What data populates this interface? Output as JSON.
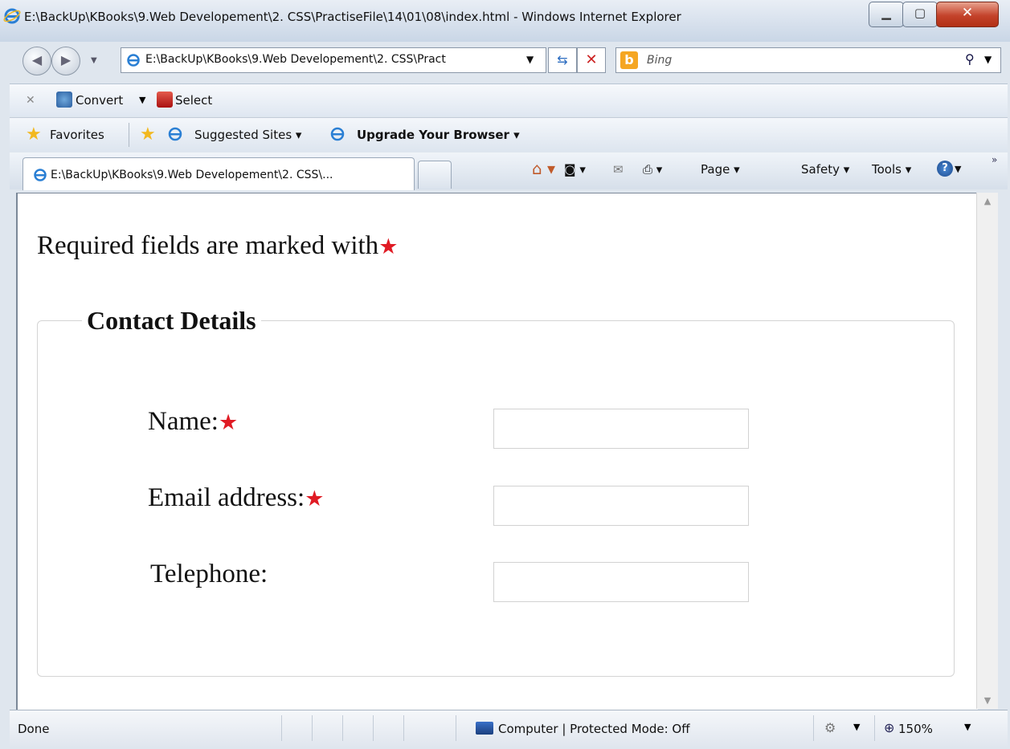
{
  "window": {
    "title": "E:\\BackUp\\KBooks\\9.Web Developement\\2. CSS\\PractiseFile\\14\\01\\08\\index.html - Windows Internet Explorer"
  },
  "address": {
    "url": "E:\\BackUp\\KBooks\\9.Web Developement\\2. CSS\\Pract",
    "search_placeholder": "Bing"
  },
  "command_bar": {
    "convert_label": "Convert",
    "select_label": "Select"
  },
  "favorites_bar": {
    "favorites_label": "Favorites",
    "suggested_sites_label": "Suggested Sites ▾",
    "upgrade_label": "Upgrade Your Browser ▾"
  },
  "tab": {
    "title": "E:\\BackUp\\KBooks\\9.Web Developement\\2. CSS\\..."
  },
  "toolbar": {
    "page_label": "Page ▾",
    "safety_label": "Safety ▾",
    "tools_label": "Tools ▾"
  },
  "page": {
    "note": "Required fields are marked with",
    "fieldset_legend": "Contact Details",
    "fields": [
      {
        "label": "Name:",
        "required": true
      },
      {
        "label": "Email address:",
        "required": true
      },
      {
        "label": "Telephone:",
        "required": false
      }
    ]
  },
  "status_bar": {
    "status": "Done",
    "zone": "Computer | Protected Mode: Off",
    "zoom": "150%"
  },
  "colors": {
    "required_star": "#e01b24",
    "close_button": "#c4432b"
  },
  "icons": [
    "ie-icon",
    "back-icon",
    "forward-icon",
    "refresh-icon",
    "stop-icon",
    "bing-icon",
    "search-icon",
    "favorites-star-icon",
    "home-icon",
    "feed-icon",
    "mail-icon",
    "print-icon",
    "help-icon",
    "computer-zone-icon",
    "zoom-icon"
  ]
}
